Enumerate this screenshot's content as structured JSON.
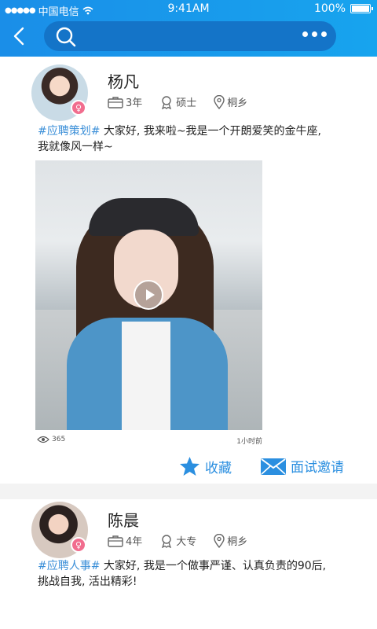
{
  "status_bar": {
    "carrier": "中国电信",
    "time": "9:41AM",
    "battery": "100%"
  },
  "search": {
    "placeholder": ""
  },
  "posts": [
    {
      "name": "杨凡",
      "years": "3年",
      "degree": "硕士",
      "location": "桐乡",
      "tag": "#应聘策划#",
      "text": " 大家好, 我来啦~我是一个开朗爱笑的金牛座,",
      "text_line2": "我就像风一样~",
      "views": "365",
      "time_ago": "1小时前",
      "actions": {
        "favorite": "收藏",
        "invite": "面试邀请"
      }
    },
    {
      "name": "陈晨",
      "years": "4年",
      "degree": "大专",
      "location": "桐乡",
      "tag": "#应聘人事#",
      "text": " 大家好, 我是一个做事严谨、认真负责的90后,",
      "text_line2": "挑战自我, 活出精彩!"
    }
  ],
  "colors": {
    "header": "#1a8ee8",
    "accent": "#2b8fe0",
    "tag": "#3b8fd8",
    "gender_female": "#f16d8e"
  },
  "icons": [
    "back-icon",
    "search-icon",
    "more-icon",
    "briefcase-icon",
    "degree-icon",
    "location-icon",
    "eye-icon",
    "star-icon",
    "mail-icon",
    "female-icon",
    "play-icon"
  ]
}
